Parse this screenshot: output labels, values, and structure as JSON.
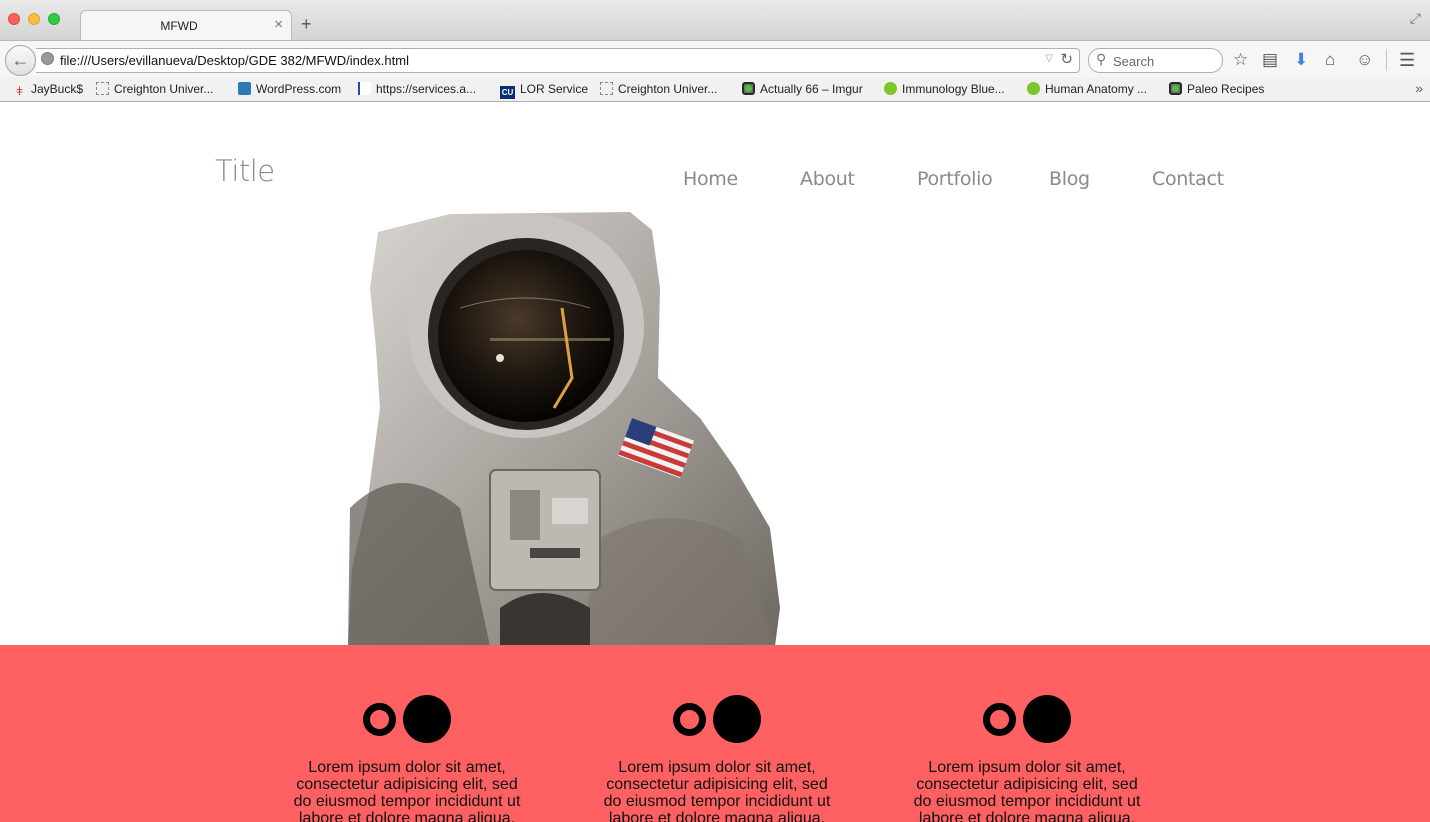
{
  "browser": {
    "tab_title": "MFWD",
    "tab_close": "×",
    "new_tab": "+",
    "url": "file:///Users/evillanueva/Desktop/GDE 382/MFWD/index.html",
    "search_placeholder": "Search",
    "bookmarks": [
      {
        "label": "JayBuck$",
        "icon": "jaybuck-icon"
      },
      {
        "label": "Creighton Univer...",
        "icon": "placeholder-page-icon"
      },
      {
        "label": "WordPress.com",
        "icon": "wordpress-icon"
      },
      {
        "label": "https://services.a...",
        "icon": "services-icon"
      },
      {
        "label": "LOR Service",
        "icon": "cu-icon"
      },
      {
        "label": "Creighton Univer...",
        "icon": "placeholder-page-icon"
      },
      {
        "label": "Actually 66 – Imgur",
        "icon": "imgur-icon"
      },
      {
        "label": "Immunology Blue...",
        "icon": "play-icon"
      },
      {
        "label": "Human Anatomy ...",
        "icon": "play-icon"
      },
      {
        "label": "Paleo Recipes",
        "icon": "imgur-icon"
      }
    ]
  },
  "site": {
    "title": "Title",
    "nav": [
      "Home",
      "About",
      "Portfolio",
      "Blog",
      "Contact"
    ],
    "accent_color": "#ff6162",
    "features": [
      {
        "text": "Lorem ipsum dolor sit amet, consectetur adipisicing elit, sed do eiusmod tempor incididunt ut labore et dolore magna aliqua."
      },
      {
        "text": "Lorem ipsum dolor sit amet, consectetur adipisicing elit, sed do eiusmod tempor incididunt ut labore et dolore magna aliqua."
      },
      {
        "text": "Lorem ipsum dolor sit amet, consectetur adipisicing elit, sed do eiusmod tempor incididunt ut labore et dolore magna aliqua."
      }
    ]
  }
}
